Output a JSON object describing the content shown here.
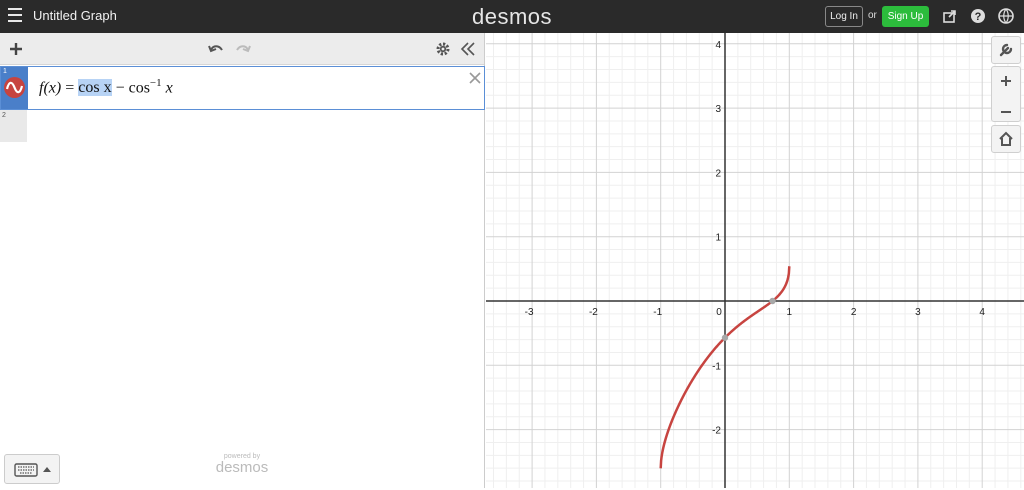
{
  "header": {
    "graph_title": "Untitled Graph",
    "brand": "desmos",
    "login_label": "Log In",
    "or_text": "or",
    "signup_label": "Sign Up",
    "icons": [
      "menu-icon",
      "share-icon",
      "help-icon",
      "language-globe-icon"
    ]
  },
  "toolbar": {
    "icons": [
      "add-icon",
      "undo-icon",
      "redo-icon",
      "settings-gear-icon",
      "collapse-panel-icon"
    ]
  },
  "expressions": [
    {
      "number": "1",
      "lhs": "f(x)",
      "equals": "=",
      "term1": "cos x",
      "minus": "−",
      "term2_base": "cos",
      "term2_exp": "−1",
      "term2_arg": "x",
      "color": "#c74440"
    },
    {
      "number": "2"
    }
  ],
  "footer": {
    "powered_small": "powered by",
    "powered_brand": "desmos"
  },
  "graph": {
    "x_ticks": [
      "-3",
      "-2",
      "-1",
      "0",
      "1",
      "2",
      "3",
      "4"
    ],
    "y_ticks": [
      "4",
      "3",
      "2",
      "1",
      "-1",
      "-2"
    ],
    "curve_color": "#c74440",
    "tools": [
      "wrench-icon",
      "zoom-in-icon",
      "zoom-out-icon",
      "home-icon"
    ]
  }
}
